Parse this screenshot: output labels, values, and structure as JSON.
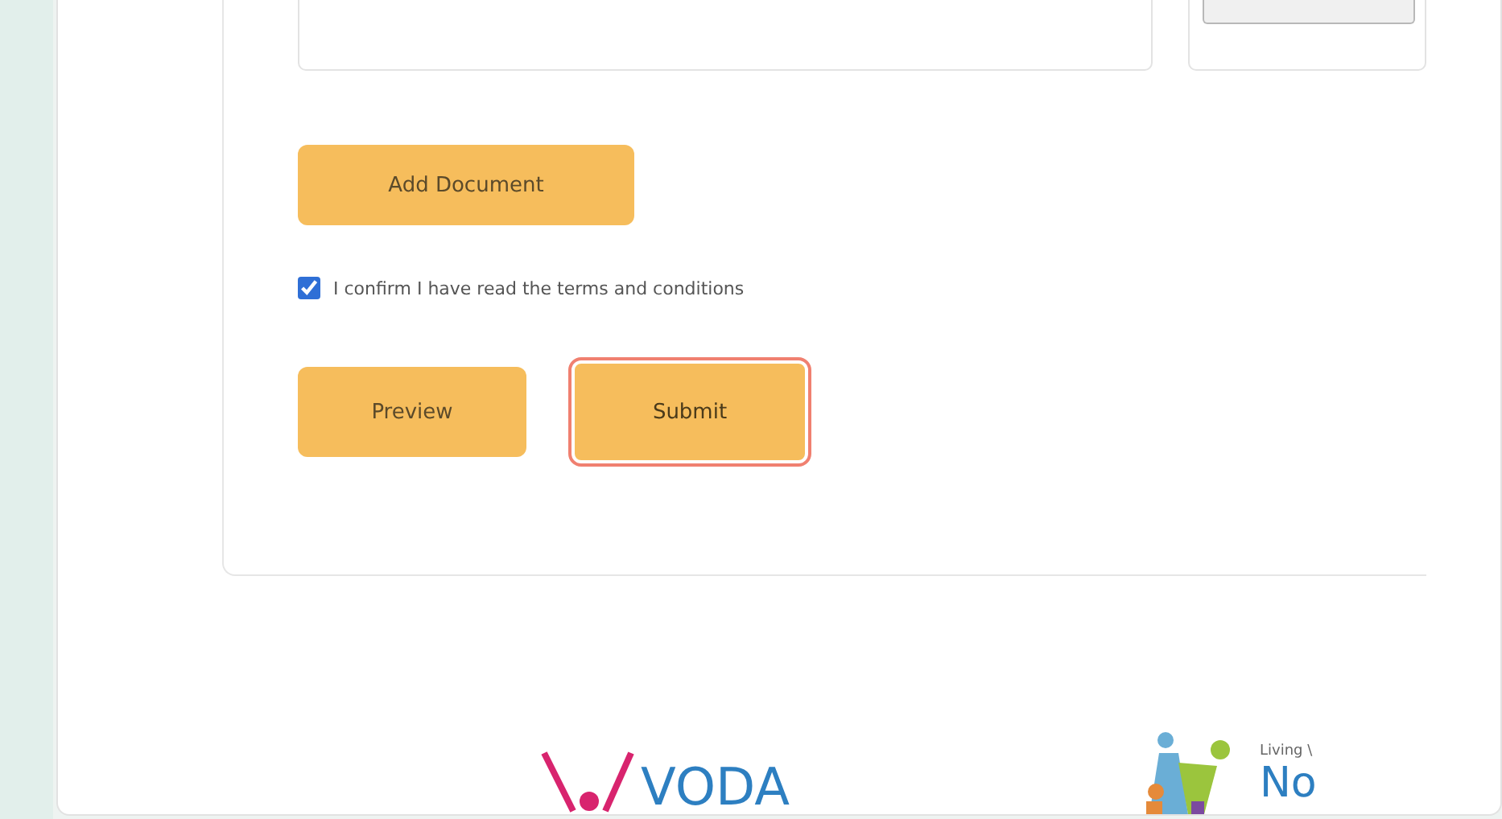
{
  "form": {
    "add_button": "Add Document",
    "confirm": {
      "label": "I confirm I have read the terms and conditions",
      "checked": true
    },
    "actions": [
      {
        "label": "Preview",
        "focused": false
      },
      {
        "label": "Submit",
        "focused": true
      }
    ]
  },
  "footer": {
    "logos": [
      {
        "kind": "voda",
        "text": "VODA"
      },
      {
        "kind": "living",
        "tagline": "Living \\",
        "text": "No"
      }
    ]
  }
}
